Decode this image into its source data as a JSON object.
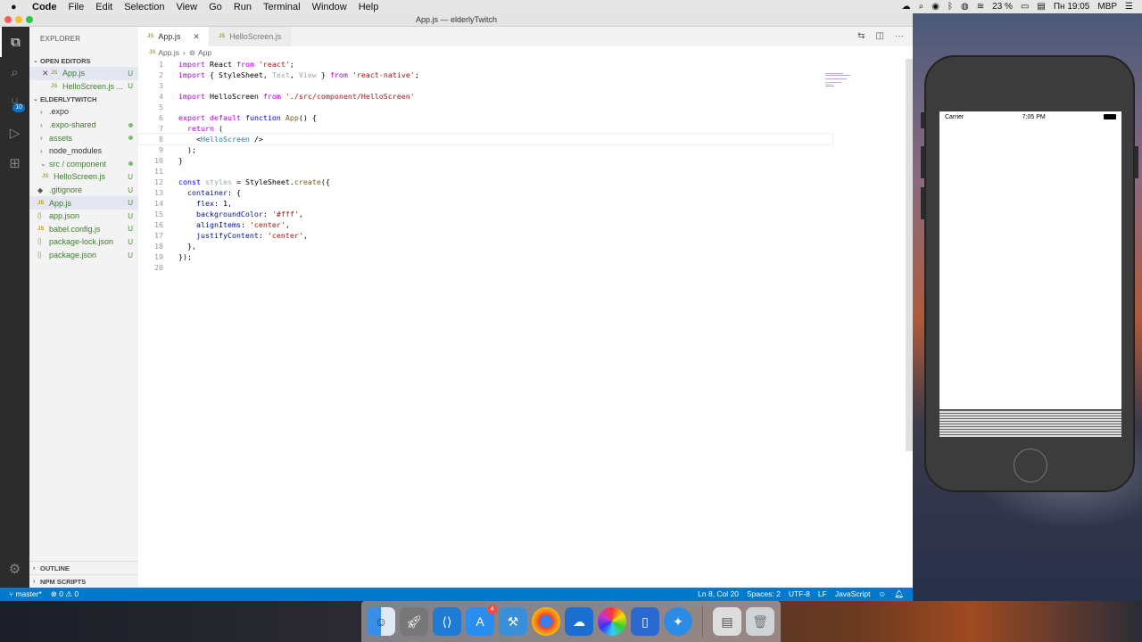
{
  "menubar": {
    "app_name": "Code",
    "items": [
      "File",
      "Edit",
      "Selection",
      "View",
      "Go",
      "Run",
      "Terminal",
      "Window",
      "Help"
    ],
    "battery": "23 %",
    "clock": "Пн 19:05",
    "machine": "MBP"
  },
  "window": {
    "title": "App.js — elderlyTwitch"
  },
  "activity": {
    "scm_badge": "10"
  },
  "sidebar": {
    "title": "EXPLORER",
    "open_editors_label": "OPEN EDITORS",
    "open_editors": [
      {
        "name": "App.js",
        "status": "U"
      },
      {
        "name": "HelloScreen.js ...",
        "status": "U"
      }
    ],
    "project_label": "ELDERLYTWITCH",
    "tree": [
      {
        "name": ".expo",
        "type": "folder",
        "status": ""
      },
      {
        "name": ".expo-shared",
        "type": "folder",
        "status": "dot"
      },
      {
        "name": "assets",
        "type": "folder",
        "status": "dot"
      },
      {
        "name": "node_modules",
        "type": "folder",
        "status": ""
      },
      {
        "name": "src / component",
        "type": "folder-open",
        "status": "dot"
      },
      {
        "name": "HelloScreen.js",
        "type": "js",
        "status": "U",
        "indent": 1
      },
      {
        "name": ".gitignore",
        "type": "git",
        "status": "U"
      },
      {
        "name": "App.js",
        "type": "js",
        "status": "U",
        "selected": true
      },
      {
        "name": "app.json",
        "type": "json",
        "status": "U"
      },
      {
        "name": "babel.config.js",
        "type": "js",
        "status": "U"
      },
      {
        "name": "package-lock.json",
        "type": "json",
        "status": "U"
      },
      {
        "name": "package.json",
        "type": "json",
        "status": "U"
      }
    ],
    "outline_label": "OUTLINE",
    "npm_label": "NPM SCRIPTS"
  },
  "tabs": [
    {
      "name": "App.js",
      "active": true
    },
    {
      "name": "HelloScreen.js",
      "active": false
    }
  ],
  "breadcrumb": {
    "file": "App.js",
    "symbol": "App"
  },
  "code_lines": [
    "import React from 'react';",
    "import { StyleSheet, Text, View } from 'react-native';",
    "",
    "import HelloScreen from './src/component/HelloScreen'",
    "",
    "export default function App() {",
    "  return (",
    "    <HelloScreen />",
    "  );",
    "}",
    "",
    "const styles = StyleSheet.create({",
    "  container: {",
    "    flex: 1,",
    "    backgroundColor: '#fff',",
    "    alignItems: 'center',",
    "    justifyContent: 'center',",
    "  },",
    "});",
    ""
  ],
  "statusbar": {
    "branch": "master*",
    "problems": "⊗ 0 ⚠ 0",
    "cursor": "Ln 8, Col 20",
    "spaces": "Spaces: 2",
    "encoding": "UTF-8",
    "eol": "LF",
    "language": "JavaScript"
  },
  "simulator": {
    "carrier": "Carrier",
    "time": "7:05 PM"
  },
  "dock": {
    "appstore_badge": "4"
  }
}
